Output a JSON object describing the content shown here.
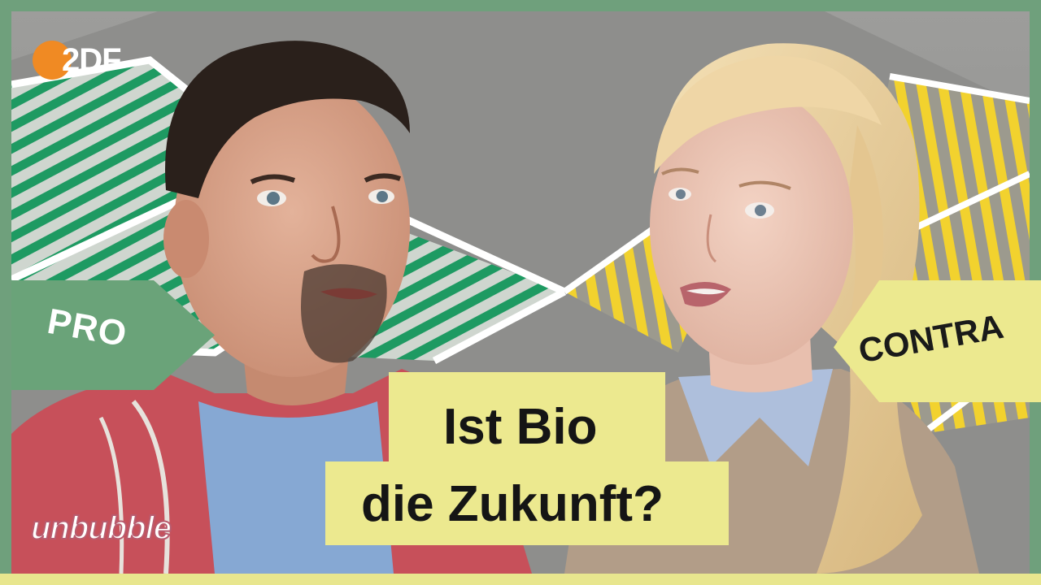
{
  "thumbnail": {
    "broadcaster_logo": "2DF",
    "pro_label": "PRO",
    "contra_label": "CONTRA",
    "headline": {
      "line1": "Ist Bio",
      "line2": "die Zukunft?"
    },
    "show_brand": "unbubble"
  },
  "colors": {
    "frame_green": "#6fa07c",
    "pro_green": "#6aa379",
    "contra_yellow": "#ece98f",
    "logo_orange": "#f08a23",
    "floor_green_stripes": "#1e9a62",
    "floor_yellow_stripes": "#f2d22e"
  }
}
